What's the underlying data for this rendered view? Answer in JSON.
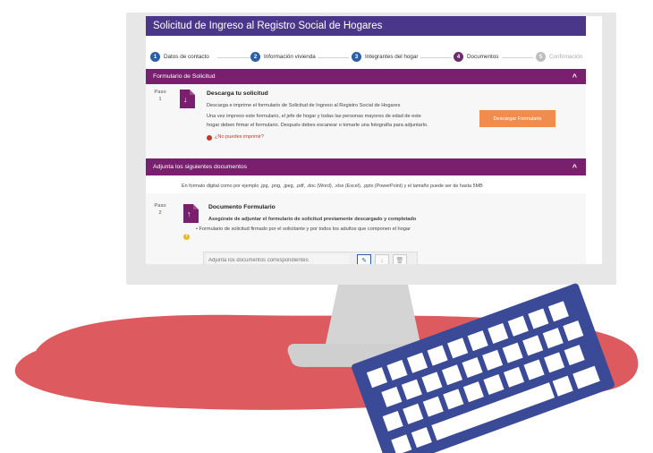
{
  "app": {
    "title": "Solicitud de Ingreso al Registro Social de Hogares"
  },
  "stepper": [
    {
      "num": "1",
      "label": "Datos de contacto",
      "state": "done"
    },
    {
      "num": "2",
      "label": "Información vivienda",
      "state": "done"
    },
    {
      "num": "3",
      "label": "Integrantes del hogar",
      "state": "done"
    },
    {
      "num": "4",
      "label": "Documentos",
      "state": "active"
    },
    {
      "num": "5",
      "label": "Confirmación",
      "state": "disabled"
    }
  ],
  "form_panel": {
    "header": "Formulario de Solicitud",
    "chevron": "^",
    "step_label": "Paso",
    "step_num": "1",
    "title": "Descarga tu solicitud",
    "line1": "Descarga e imprime el formulario de Solicitud de Ingreso al Registro Social de Hogares",
    "line2": "Una vez impreso este formulario, el jefe de hogar y todas las personas mayores de edad de este",
    "line3": "hogar deben firmar el formulario. Después debes escanear o tomarle una fotografía para adjuntarlo.",
    "link": "¿No puedes imprimir?",
    "download_button": "Descargar Formulario"
  },
  "docs_panel": {
    "header": "Adjunta los siguientes documentos",
    "chevron": "^",
    "note": "En formato digital como por ejemplo .jpg, .png, .jpeg, .pdf, .doc (Word), .xlsx (Excel), .pptx (PowerPoint) y el tamaño puede ser de hasta 5MB",
    "step_label": "Paso",
    "step_num": "2",
    "title": "Documento Formulario",
    "subtitle": "Asegúrate de adjuntar el formulario de solicitud previamente descargado y completado",
    "bullet": "• Formulario de solicitud firmado por el solicitante y por todos los adultos que componen el hogar",
    "warn_glyph": "?",
    "upload_placeholder": "Adjunta los documentos correspondientes",
    "upload_icon": "✎",
    "download_icon": "↓",
    "delete_icon": "🗑"
  },
  "colors": {
    "header": "#4b3789",
    "panel": "#7a1f6e",
    "step_done": "#2b5fa6",
    "step_active": "#6d2b6e",
    "button": "#f08d4e",
    "blob": "#dd5a5e",
    "keyboard": "#3b4a96"
  }
}
